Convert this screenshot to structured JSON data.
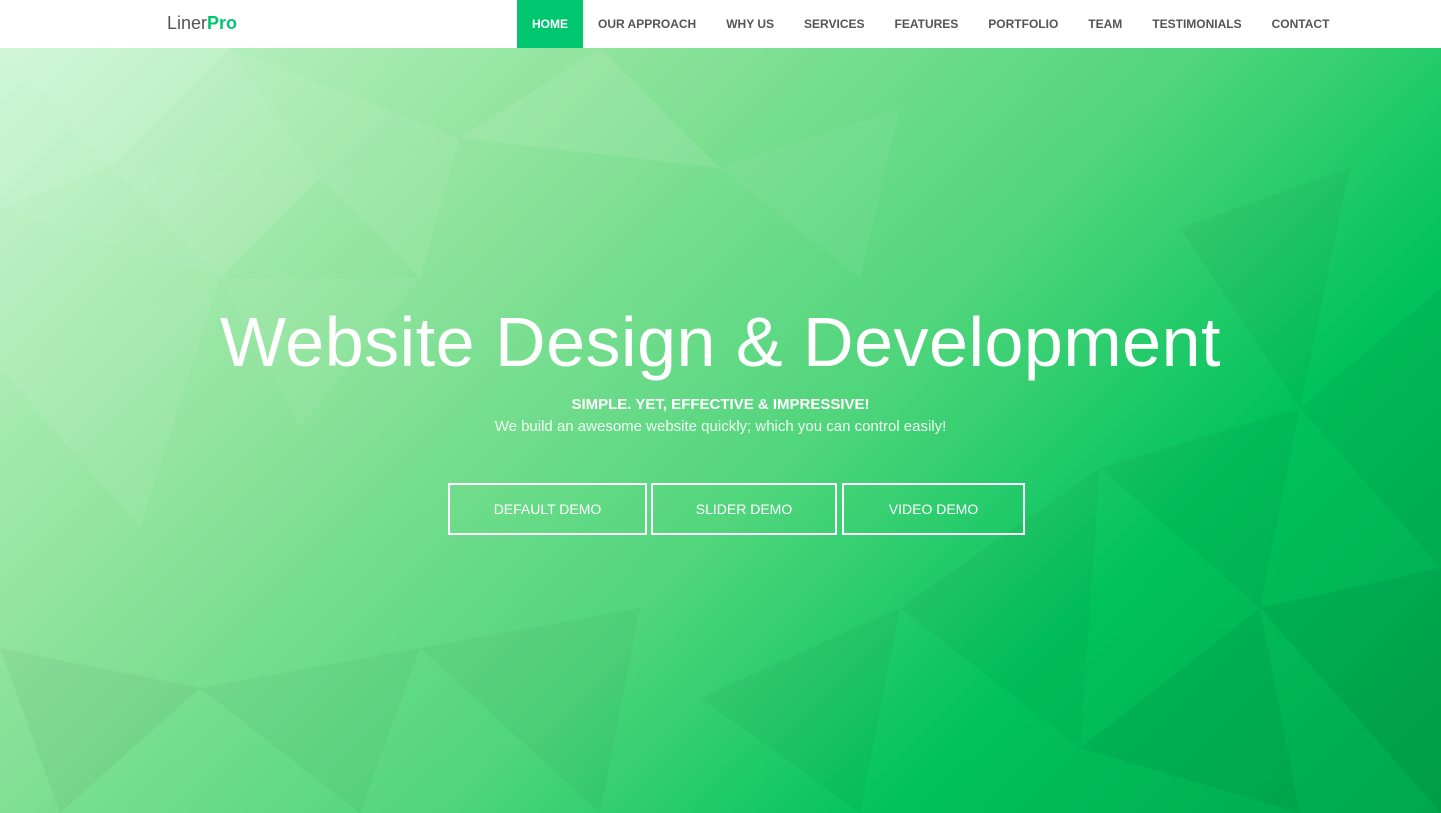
{
  "colors": {
    "accent": "#00c76f",
    "nav_text": "#555555",
    "hero_gradient_start": "#c8f5cf",
    "hero_gradient_end": "#00a64d",
    "button_border": "#ffffff"
  },
  "brand": {
    "light": "Liner",
    "bold": "Pro"
  },
  "nav": {
    "items": [
      {
        "label": "HOME",
        "active": true
      },
      {
        "label": "OUR APPROACH",
        "active": false
      },
      {
        "label": "WHY US",
        "active": false
      },
      {
        "label": "SERVICES",
        "active": false
      },
      {
        "label": "FEATURES",
        "active": false
      },
      {
        "label": "PORTFOLIO",
        "active": false
      },
      {
        "label": "TEAM",
        "active": false
      },
      {
        "label": "TESTIMONIALS",
        "active": false
      },
      {
        "label": "CONTACT",
        "active": false
      }
    ]
  },
  "hero": {
    "title": "Website Design & Development",
    "tagline": "SIMPLE. YET, EFFECTIVE & IMPRESSIVE!",
    "subtitle": "We build an awesome website quickly; which you can control easily!",
    "buttons": [
      {
        "label": "DEFAULT DEMO"
      },
      {
        "label": "SLIDER DEMO"
      },
      {
        "label": "VIDEO DEMO"
      }
    ]
  }
}
